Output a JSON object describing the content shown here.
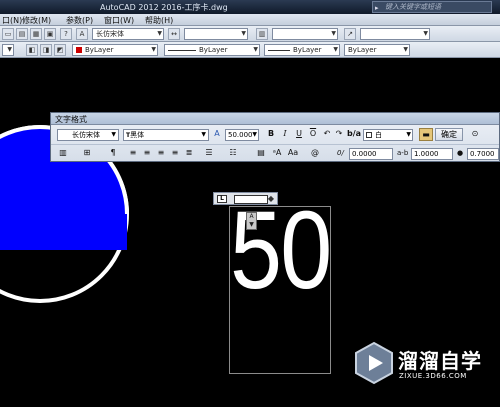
{
  "window": {
    "title": "AutoCAD 2012    2016-工序卡.dwg",
    "search_placeholder": "键入关键字或短语"
  },
  "menu": {
    "items": [
      "口(N)",
      "修改(M)",
      "参数(P)",
      "窗口(W)",
      "帮助(H)"
    ]
  },
  "toolbar1": {
    "font_style": "长仿宋体"
  },
  "toolbar2": {
    "layer_color": "ByLayer",
    "linetype": "ByLayer",
    "lineweight": "ByLayer",
    "plotstyle": "ByLayer",
    "color_hex": "#cc0000"
  },
  "text_format": {
    "title": "文字格式",
    "style": "长仿宋体",
    "font": "黑体",
    "height": "50.000",
    "bold": "B",
    "italic": "I",
    "underline": "U",
    "overline": "O",
    "color": "白",
    "ok": "确定",
    "oblique_value": "0.0000",
    "tracking_label": "a-b",
    "tracking_value": "1.0000",
    "width_value": "0.7000"
  },
  "editor": {
    "ruler_tag": "L",
    "content": "50"
  },
  "watermark": {
    "name": "溜溜自学",
    "url": "ZIXUE.3D66.COM"
  },
  "colors": {
    "circle": "#0000ff",
    "canvas": "#000000"
  }
}
